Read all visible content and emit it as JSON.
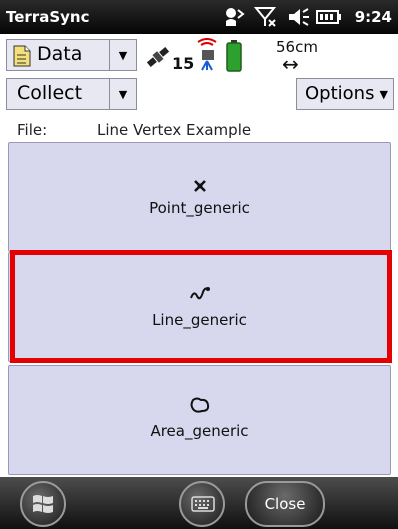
{
  "status": {
    "app_title": "TerraSync",
    "time": "9:24",
    "icons": [
      "connection-sync-icon",
      "no-signal-icon",
      "volume-icon",
      "battery-icon"
    ]
  },
  "toolbar": {
    "section": "Data",
    "satellites": "15",
    "accuracy": "56cm",
    "mode": "Collect",
    "options_label": "Options"
  },
  "file": {
    "label": "File:",
    "name": "Line Vertex Example"
  },
  "features": [
    {
      "label": "Point_generic",
      "icon": "point-icon",
      "selected": false
    },
    {
      "label": "Line_generic",
      "icon": "line-icon",
      "selected": true
    },
    {
      "label": "Area_generic",
      "icon": "area-icon",
      "selected": false
    }
  ],
  "taskbar": {
    "close_label": "Close",
    "start_icon": "windows-start-icon",
    "keyboard_icon": "keyboard-icon"
  },
  "colors": {
    "selection": "#e40000",
    "button_fill": "#d7d7ee",
    "battery": "#2ea02e"
  }
}
